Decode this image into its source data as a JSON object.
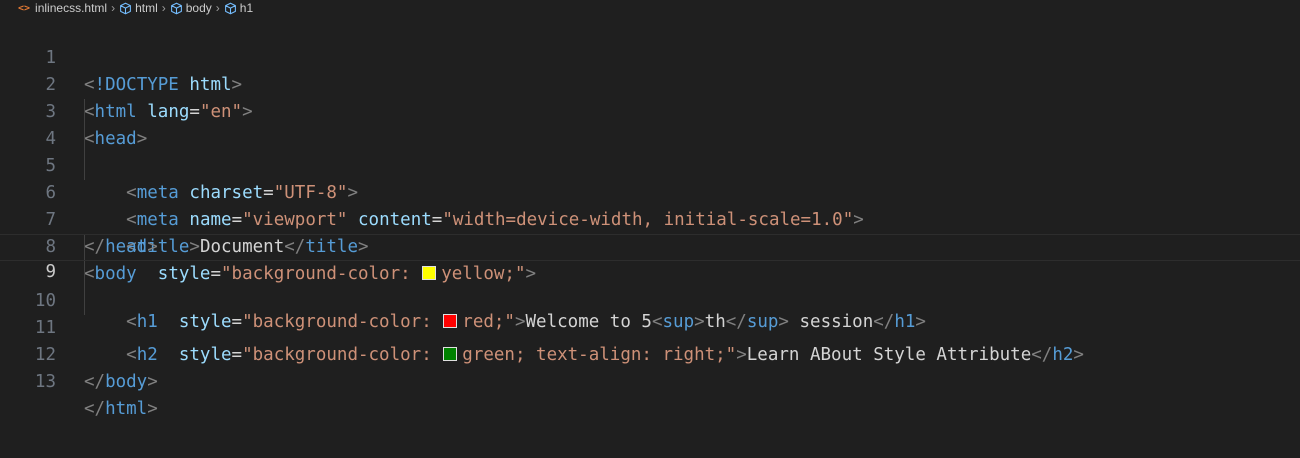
{
  "breadcrumb": {
    "file": "inlinecss.html",
    "items": [
      "html",
      "body",
      "h1"
    ]
  },
  "line_numbers": [
    "1",
    "2",
    "3",
    "4",
    "5",
    "6",
    "7",
    "8",
    "9",
    "10",
    "11",
    "12",
    "13"
  ],
  "tokens": {
    "lt": "<",
    "gt": ">",
    "lt_slash": "</",
    "eq": "=",
    "doctype": "!DOCTYPE",
    "html": "html",
    "head": "head",
    "meta": "meta",
    "title": "title",
    "body": "body",
    "h1": "h1",
    "h2": "h2",
    "sup": "sup",
    "lang": "lang",
    "charset": "charset",
    "name": "name",
    "content": "content",
    "style": "style",
    "str_en": "\"en\"",
    "str_utf8": "\"UTF-8\"",
    "str_viewport": "\"viewport\"",
    "str_content": "\"width=device-width, initial-scale=1.0\"",
    "str_bg_prefix": "\"background-color: ",
    "str_yellow": "yellow;\"",
    "str_red": "red;\"",
    "str_green": "green; text-align: right;\"",
    "text_document": "Document",
    "text_welcome": "Welcome to 5",
    "text_th": "th",
    "text_session": " session",
    "text_learn": "Learn ABout Style Attribute"
  },
  "swatch_colors": {
    "yellow": "#ffff00",
    "red": "#ff0000",
    "green": "#008000"
  },
  "theme": {
    "background": "#1f1f1f",
    "tag": "#569cd6",
    "attribute": "#9cdcfe",
    "string": "#ce9178",
    "punctuation": "#808080",
    "text": "#d4d4d4"
  }
}
